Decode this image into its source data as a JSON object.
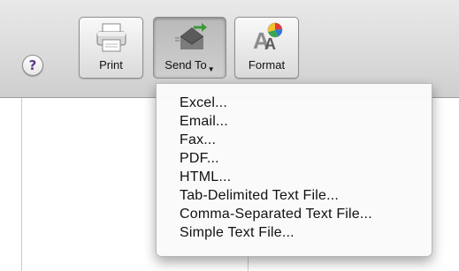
{
  "toolbar": {
    "help_label": "?",
    "print_label": "Print",
    "send_to_label": "Send To",
    "format_label": "Format"
  },
  "send_to_menu": {
    "items": [
      {
        "label": "Excel..."
      },
      {
        "label": "Email..."
      },
      {
        "label": "Fax..."
      },
      {
        "label": "PDF..."
      },
      {
        "label": "HTML..."
      },
      {
        "label": "Tab-Delimited Text File..."
      },
      {
        "label": "Comma-Separated Text File..."
      },
      {
        "label": "Simple Text File..."
      }
    ]
  },
  "icons": {
    "help": "help-icon",
    "print": "printer-icon",
    "send_to": "envelope-send-icon",
    "format": "format-text-color-icon",
    "dropdown": "dropdown-arrow-icon"
  },
  "colors": {
    "send_arrow": "#3a9a3a",
    "help_text": "#5b3a8e"
  }
}
